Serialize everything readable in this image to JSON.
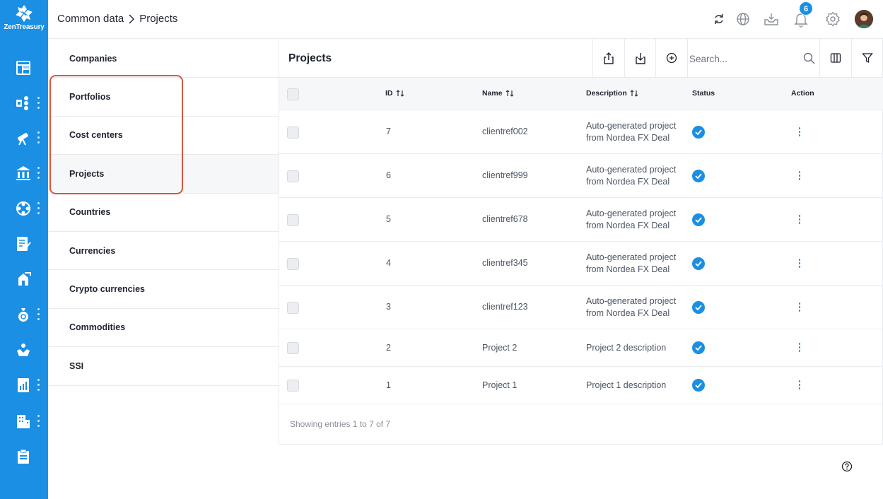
{
  "app": {
    "logo_text": "ZenTreasury"
  },
  "rail": {
    "items": [
      {
        "icon": "dashboard-icon",
        "has_menu": false
      },
      {
        "icon": "flow-icon",
        "has_menu": true
      },
      {
        "icon": "telescope-icon",
        "has_menu": true
      },
      {
        "icon": "bank-icon",
        "has_menu": true
      },
      {
        "icon": "network-icon",
        "has_menu": true
      },
      {
        "icon": "document-icon",
        "has_menu": false
      },
      {
        "icon": "house-transfer-icon",
        "has_menu": false
      },
      {
        "icon": "money-bag-icon",
        "has_menu": true
      },
      {
        "icon": "hand-icon",
        "has_menu": false
      },
      {
        "icon": "report-icon",
        "has_menu": true
      },
      {
        "icon": "building-icon",
        "has_menu": true
      },
      {
        "icon": "clipboard-icon",
        "has_menu": false
      }
    ]
  },
  "header": {
    "breadcrumb": {
      "parent": "Common data",
      "current": "Projects"
    },
    "notifications_count": "6",
    "icons": [
      "refresh-icon",
      "globe-icon",
      "inbox-download-icon",
      "bell-icon",
      "settings-icon",
      "avatar"
    ]
  },
  "categories": {
    "items": [
      {
        "label": "Companies",
        "active": false
      },
      {
        "label": "Portfolios",
        "active": false
      },
      {
        "label": "Cost centers",
        "active": false
      },
      {
        "label": "Projects",
        "active": true
      },
      {
        "label": "Countries",
        "active": false
      },
      {
        "label": "Currencies",
        "active": false
      },
      {
        "label": "Crypto currencies",
        "active": false
      },
      {
        "label": "Commodities",
        "active": false
      },
      {
        "label": "SSI",
        "active": false
      }
    ],
    "highlighted": [
      "Portfolios",
      "Cost centers",
      "Projects"
    ],
    "highlight_color": "#d9553f"
  },
  "panel": {
    "title": "Projects",
    "search": {
      "placeholder": "Search...",
      "value": ""
    },
    "table": {
      "columns": {
        "id": "ID",
        "name": "Name",
        "description": "Description",
        "status": "Status",
        "action": "Action"
      },
      "rows": [
        {
          "id": "7",
          "name": "clientref002",
          "description": "Auto-generated project from Nordea FX Deal",
          "status": "active"
        },
        {
          "id": "6",
          "name": "clientref999",
          "description": "Auto-generated project from Nordea FX Deal",
          "status": "active"
        },
        {
          "id": "5",
          "name": "clientref678",
          "description": "Auto-generated project from Nordea FX Deal",
          "status": "active"
        },
        {
          "id": "4",
          "name": "clientref345",
          "description": "Auto-generated project from Nordea FX Deal",
          "status": "active"
        },
        {
          "id": "3",
          "name": "clientref123",
          "description": "Auto-generated project from Nordea FX Deal",
          "status": "active"
        },
        {
          "id": "2",
          "name": "Project 2",
          "description": "Project 2 description",
          "status": "active"
        },
        {
          "id": "1",
          "name": "Project 1",
          "description": "Project 1 description",
          "status": "active"
        }
      ]
    },
    "footer": "Showing entries 1 to 7 of 7"
  },
  "colors": {
    "brand": "#1a8fe3",
    "status_active": "#1a8fe3",
    "border": "#e8eaed"
  }
}
